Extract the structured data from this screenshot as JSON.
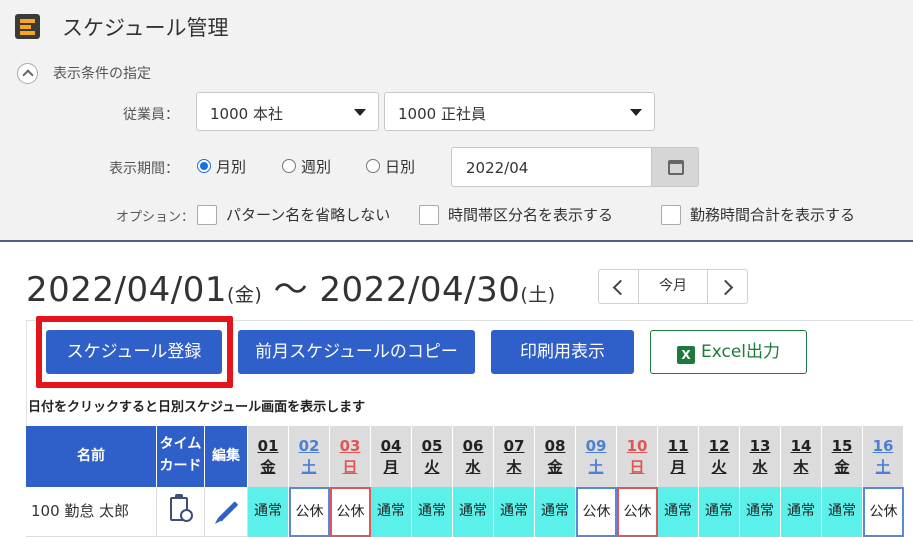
{
  "app": {
    "title": "スケジュール管理"
  },
  "filter": {
    "heading": "表示条件の指定",
    "employee_label": "従業員：",
    "employee_select": "1000 本社",
    "employment_select": "1000 正社員",
    "period_label": "表示期間：",
    "period_options": [
      {
        "label": "月別",
        "selected": true
      },
      {
        "label": "週別",
        "selected": false
      },
      {
        "label": "日別",
        "selected": false
      }
    ],
    "date_value": "2022/04",
    "option_label": "オプション：",
    "options": [
      {
        "label": "パターン名を省略しない",
        "checked": false
      },
      {
        "label": "時間帯区分名を表示する",
        "checked": false
      },
      {
        "label": "勤務時間合計を表示する",
        "checked": false
      }
    ]
  },
  "range": {
    "start": "2022/04/01",
    "start_weekday": "(金)",
    "separator": "〜",
    "end": "2022/04/30",
    "end_weekday": "(土)"
  },
  "pager": {
    "today_label": "今月"
  },
  "actions": {
    "register": "スケジュール登録",
    "copy_prev": "前月スケジュールのコピー",
    "print": "印刷用表示",
    "excel": "Excel出力"
  },
  "hint": "日付をクリックすると日別スケジュール画面を表示します",
  "table": {
    "headers": {
      "name": "名前",
      "timecard_1": "タイム",
      "timecard_2": "カード",
      "edit": "編集"
    },
    "days": [
      {
        "day": "01",
        "weekday": "金",
        "type": "weekday"
      },
      {
        "day": "02",
        "weekday": "土",
        "type": "sat"
      },
      {
        "day": "03",
        "weekday": "日",
        "type": "sun"
      },
      {
        "day": "04",
        "weekday": "月",
        "type": "weekday"
      },
      {
        "day": "05",
        "weekday": "火",
        "type": "weekday"
      },
      {
        "day": "06",
        "weekday": "水",
        "type": "weekday"
      },
      {
        "day": "07",
        "weekday": "木",
        "type": "weekday"
      },
      {
        "day": "08",
        "weekday": "金",
        "type": "weekday"
      },
      {
        "day": "09",
        "weekday": "土",
        "type": "sat"
      },
      {
        "day": "10",
        "weekday": "日",
        "type": "sun"
      },
      {
        "day": "11",
        "weekday": "月",
        "type": "weekday"
      },
      {
        "day": "12",
        "weekday": "火",
        "type": "weekday"
      },
      {
        "day": "13",
        "weekday": "水",
        "type": "weekday"
      },
      {
        "day": "14",
        "weekday": "木",
        "type": "weekday"
      },
      {
        "day": "15",
        "weekday": "金",
        "type": "weekday"
      },
      {
        "day": "16",
        "weekday": "土",
        "type": "sat"
      }
    ],
    "rows": [
      {
        "name": "100 勤怠 太郎",
        "schedule": [
          "通常",
          "公休",
          "公休",
          "通常",
          "通常",
          "通常",
          "通常",
          "通常",
          "公休",
          "公休",
          "通常",
          "通常",
          "通常",
          "通常",
          "通常",
          "公休"
        ]
      }
    ]
  },
  "colors": {
    "primary": "#2f5fc9",
    "highlight": "#e5131b",
    "work_cell": "#5cf0ea",
    "saturday": "#4d7fd6",
    "sunday": "#e05656",
    "excel_green": "#1e7a3b"
  }
}
